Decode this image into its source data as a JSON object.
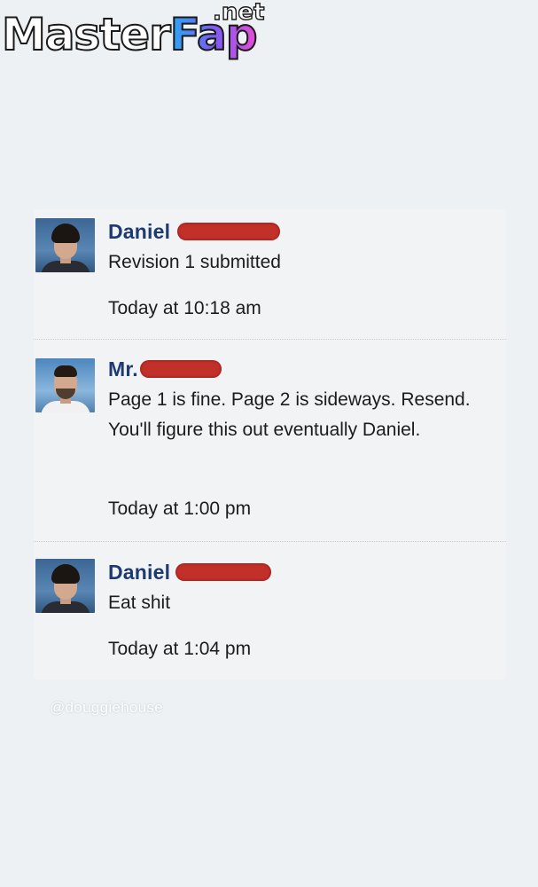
{
  "watermark": {
    "main_part_1": "Master",
    "main_part_2": "Fap",
    "suffix": ".net"
  },
  "messages": [
    {
      "sender": "Daniel",
      "text": "Revision 1 submitted",
      "time": "Today at 10:18 am"
    },
    {
      "sender": "Mr.",
      "text": "Page 1 is fine. Page 2 is sideways. Resend. You'll figure this out eventually Daniel.",
      "time": "Today at 1:00 pm"
    },
    {
      "sender": "Daniel",
      "text": "Eat shit",
      "time": "Today at 1:04 pm"
    }
  ],
  "credit": "@douggiehouse",
  "colors": {
    "sender_name": "#1d3a73",
    "redaction": "#c2302a",
    "thread_background": "#f2f3f5",
    "page_background": "#eef1f3"
  }
}
